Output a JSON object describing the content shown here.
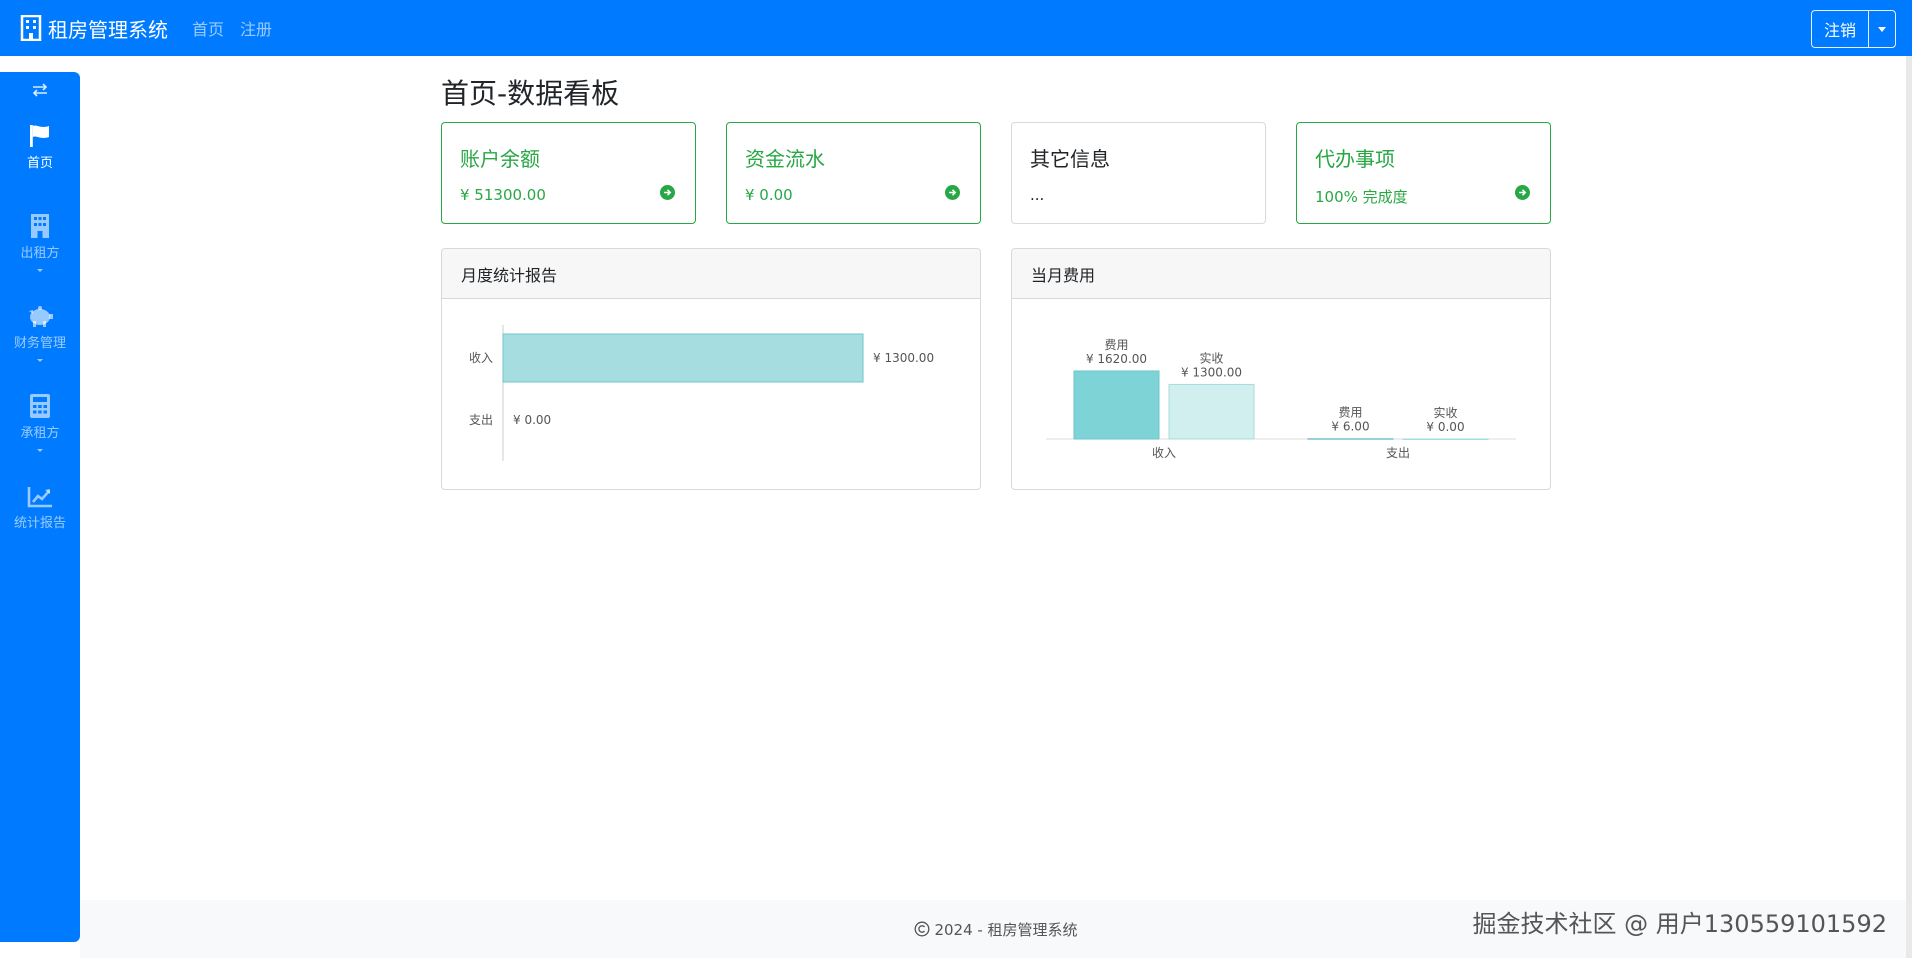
{
  "navbar": {
    "brand": "租房管理系统",
    "links": [
      "首页",
      "注册"
    ],
    "logout_label": "注销"
  },
  "sidebar": {
    "items": [
      {
        "label": "首页",
        "icon": "flag-icon"
      },
      {
        "label": "出租方",
        "icon": "building-icon"
      },
      {
        "label": "财务管理",
        "icon": "piggy-bank-icon"
      },
      {
        "label": "承租方",
        "icon": "calculator-icon"
      },
      {
        "label": "统计报告",
        "icon": "chart-line-icon"
      }
    ]
  },
  "page": {
    "title": "首页-数据看板"
  },
  "cards": [
    {
      "title": "账户余额",
      "text": "¥ 51300.00"
    },
    {
      "title": "资金流水",
      "text": "¥ 0.00"
    },
    {
      "title": "其它信息",
      "text": "..."
    },
    {
      "title": "代办事项",
      "text": "100% 完成度"
    }
  ],
  "panels": {
    "monthly_title": "月度统计报告",
    "current_title": "当月费用"
  },
  "chart_data": [
    {
      "type": "bar",
      "orientation": "horizontal",
      "categories": [
        "收入",
        "支出"
      ],
      "values": [
        1300,
        0
      ],
      "data_labels": [
        "¥ 1300.00",
        "¥ 0.00"
      ],
      "colors": {
        "bar": "#a6dde0",
        "bar_border": "#6cc6cb"
      }
    },
    {
      "type": "bar",
      "categories": [
        "收入",
        "支出"
      ],
      "series": [
        {
          "values": [
            1620,
            6
          ],
          "labels": [
            "费用\n¥ 1620.00",
            "费用\n¥ 6.00"
          ],
          "color": "#7dd3d6"
        },
        {
          "values": [
            1300,
            0
          ],
          "labels": [
            "实收\n¥ 1300.00",
            "实收\n¥ 0.00"
          ],
          "color": "#d0efee"
        }
      ]
    }
  ],
  "footer": {
    "text": "2024 - 租房管理系统"
  },
  "watermark": "掘金技术社区 @ 用户130559101592"
}
